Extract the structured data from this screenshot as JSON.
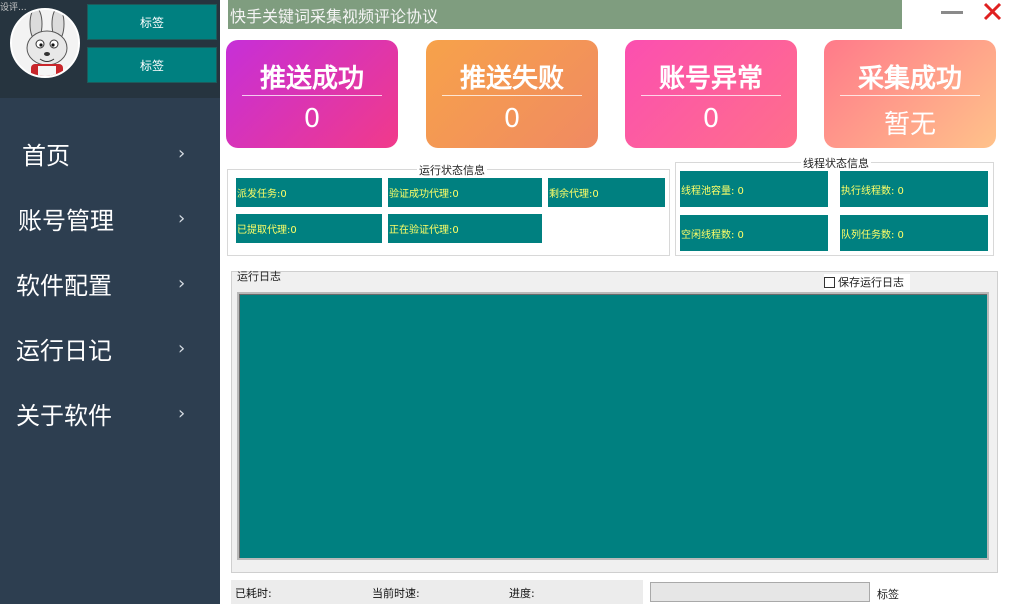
{
  "window": {
    "tiny_title": "设评...",
    "title": "快手关键词采集视频评论协议"
  },
  "sidebar": {
    "tag_top": "标签",
    "tag_bottom": "标签",
    "items": [
      {
        "label": "首页",
        "chev": "›"
      },
      {
        "label": "账号管理",
        "chev": "›"
      },
      {
        "label": "软件配置",
        "chev": "›"
      },
      {
        "label": "运行日记",
        "chev": "›"
      },
      {
        "label": "关于软件",
        "chev": "›"
      }
    ]
  },
  "cards": [
    {
      "title": "推送成功",
      "value": "0",
      "gradient_from": "#c62fd8",
      "gradient_to": "#f13a8a"
    },
    {
      "title": "推送失败",
      "value": "0",
      "gradient_from": "#f7a24a",
      "gradient_to": "#f08a62"
    },
    {
      "title": "账号异常",
      "value": "0",
      "gradient_from": "#fb4fb0",
      "gradient_to": "#ff6f8b"
    },
    {
      "title": "采集成功",
      "value": "暂无",
      "gradient_from": "#ff7a8a",
      "gradient_to": "#ffc28a"
    }
  ],
  "run_status": {
    "title": "运行状态信息",
    "dispatched": "派发任务:0",
    "verify_success": "验证成功代理:0",
    "remaining": "剩余代理:0",
    "fetched": "已提取代理:0",
    "verifying": "正在验证代理:0"
  },
  "thread_status": {
    "title": "线程状态信息",
    "pool_capacity": "线程池容量: 0",
    "running_threads": "执行线程数: 0",
    "idle_threads": "空闲线程数: 0",
    "queue_tasks": "队列任务数: 0"
  },
  "log": {
    "title": "运行日志",
    "save_label": "保存运行日志",
    "save_checked": false
  },
  "status_bar": {
    "elapsed": "已耗时:",
    "speed": "当前时速:",
    "progress": "进度:",
    "progress_value": 0,
    "label": "标签"
  },
  "colors": {
    "sidebar_bg": "#2d3e50",
    "accent_teal": "#008080",
    "title_bar": "#7f9d7f",
    "info_text": "#ffff66",
    "close_red": "#e02020"
  }
}
